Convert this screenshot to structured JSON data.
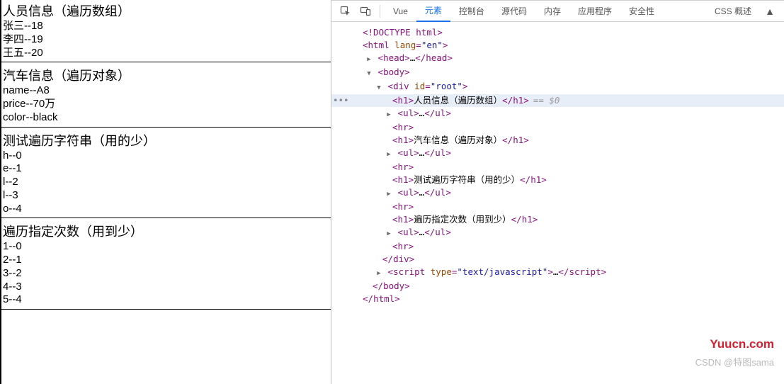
{
  "left": {
    "section1": {
      "title": "人员信息（遍历数组）",
      "items": [
        "张三--18",
        "李四--19",
        "王五--20"
      ]
    },
    "section2": {
      "title": "汽车信息（遍历对象）",
      "items": [
        "name--A8",
        "price--70万",
        "color--black"
      ]
    },
    "section3": {
      "title": "测试遍历字符串（用的少）",
      "items": [
        "h--0",
        "e--1",
        "l--2",
        "l--3",
        "o--4"
      ]
    },
    "section4": {
      "title": "遍历指定次数（用到少）",
      "items": [
        "1--0",
        "2--1",
        "3--2",
        "4--3",
        "5--4"
      ]
    }
  },
  "tabs": {
    "vue": "Vue",
    "elements": "元素",
    "console": "控制台",
    "sources": "源代码",
    "memory": "内存",
    "application": "应用程序",
    "security": "安全性",
    "css": "CSS 概述"
  },
  "tree": {
    "doctype": "<!DOCTYPE html>",
    "html_open": "html",
    "html_lang_attr": "lang",
    "html_lang_val": "\"en\"",
    "head": "head",
    "body": "body",
    "div": "div",
    "div_id_attr": "id",
    "div_id_val": "\"root\"",
    "h1": "h1",
    "ul": "ul",
    "hr": "hr",
    "h1_text1": "人员信息（遍历数组）",
    "h1_text2": "汽车信息（遍历对象）",
    "h1_text3": "测试遍历字符串（用的少）",
    "h1_text4": "遍历指定次数（用到少）",
    "script": "script",
    "script_type_attr": "type",
    "script_type_val": "\"text/javascript\"",
    "ellipsis": "…",
    "sel_marker": "== $0",
    "dots": "•••"
  },
  "watermark1": "Yuucn.com",
  "watermark2": "CSDN @特图sama"
}
